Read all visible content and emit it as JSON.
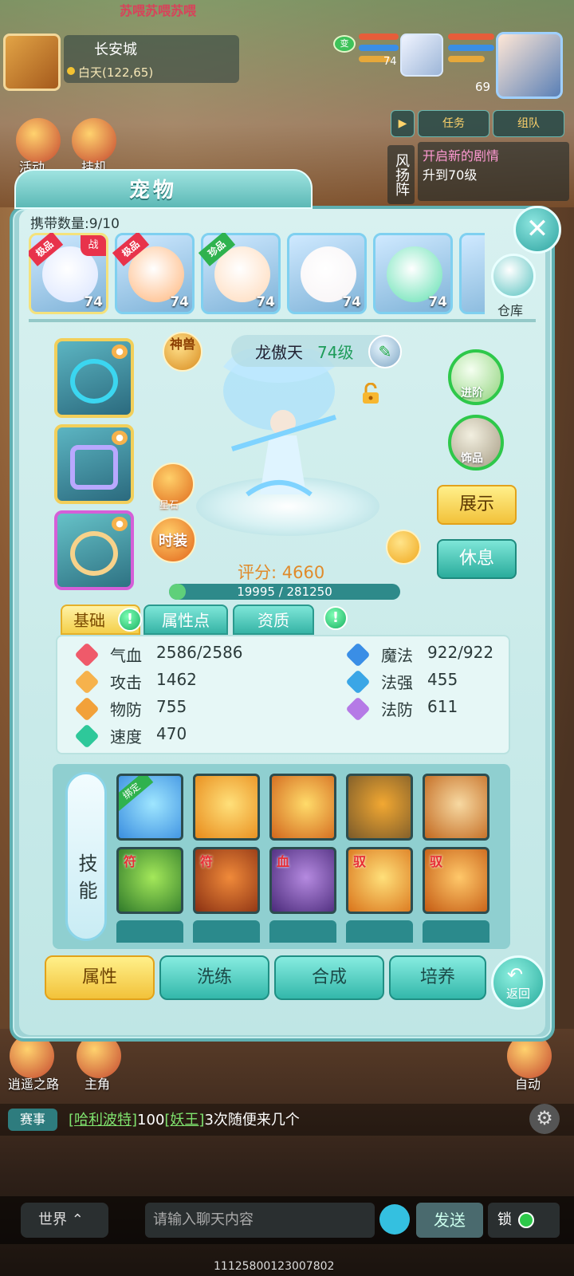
{
  "hud": {
    "marquee": "苏喂苏喂苏喂",
    "city_name": "长安城",
    "city_coords": "白天(122,65)",
    "team_badge": "变",
    "member_small_level": "74",
    "member_large_level": "69",
    "quest_tab": "任务",
    "team_tab": "组队",
    "formation_label": "风扬阵",
    "quest_title": "开启新的剧情",
    "quest_desc": "升到70级",
    "activity_label": "活动",
    "idle_label": "挂机",
    "xiaoyao_label": "逍遥之路",
    "hero_label": "主角",
    "auto_label": "自动"
  },
  "panel": {
    "title": "宠物",
    "carry_count": "携带数量:9/10",
    "storage_label": "仓库",
    "close_icon": "close-icon"
  },
  "pets": [
    {
      "grade": "极品",
      "level": "74",
      "tag": "战",
      "ribbon_color": "#e8334b",
      "face": "#d9e4ff"
    },
    {
      "grade": "极品",
      "level": "74",
      "tag": "",
      "ribbon_color": "#e8334b",
      "face": "#ffb57a"
    },
    {
      "grade": "珍品",
      "level": "74",
      "tag": "",
      "ribbon_color": "#2fb24e",
      "face": "#ffd9b8"
    },
    {
      "grade": "",
      "level": "74",
      "tag": "",
      "ribbon_color": "",
      "face": "#f7f3f5"
    },
    {
      "grade": "",
      "level": "74",
      "tag": "",
      "ribbon_color": "",
      "face": "#5fe0b0"
    }
  ],
  "pet_detail": {
    "divine_badge": "神兽",
    "name": "龙傲天",
    "level": "74级",
    "star_stone_label": "星石",
    "fashion_label": "时装",
    "advance_label": "进阶",
    "ornament_label": "饰品",
    "show_label": "展示",
    "rest_label": "休息",
    "score_text": "评分: 4660",
    "exp_text": "19995 / 281250",
    "exp_fraction": 0.071
  },
  "tabs": [
    {
      "label": "基础",
      "active": true
    },
    {
      "label": "属性点",
      "active": false
    },
    {
      "label": "资质",
      "active": false
    }
  ],
  "stats": {
    "hp_label": "气血",
    "hp_value": "2586/2586",
    "mp_label": "魔法",
    "mp_value": "922/922",
    "atk_label": "攻击",
    "atk_value": "1462",
    "mag_label": "法强",
    "mag_value": "455",
    "def_label": "物防",
    "def_value": "755",
    "mdef_label": "法防",
    "mdef_value": "611",
    "spd_label": "速度",
    "spd_value": "470"
  },
  "skills": {
    "label": "技能",
    "row1": [
      {
        "tag": "",
        "bound": "绑定",
        "colors": [
          "#3a8ee0",
          "#9fe6ff"
        ]
      },
      {
        "tag": "",
        "bound": "",
        "colors": [
          "#e88a1a",
          "#ffe07a"
        ]
      },
      {
        "tag": "",
        "bound": "",
        "colors": [
          "#d2661c",
          "#ffdb6a"
        ]
      },
      {
        "tag": "",
        "bound": "",
        "colors": [
          "#7a5a2a",
          "#f2a832"
        ]
      },
      {
        "tag": "",
        "bound": "",
        "colors": [
          "#c2681e",
          "#f7d9a2"
        ]
      }
    ],
    "row2": [
      {
        "tag": "符",
        "bound": "",
        "colors": [
          "#2f7a2a",
          "#a4e85a"
        ]
      },
      {
        "tag": "符",
        "bound": "",
        "colors": [
          "#8a3012",
          "#f08a3a"
        ]
      },
      {
        "tag": "血",
        "bound": "",
        "colors": [
          "#4a2a7a",
          "#b58ae0"
        ]
      },
      {
        "tag": "驭",
        "bound": "",
        "colors": [
          "#d9731a",
          "#ffe07a"
        ]
      },
      {
        "tag": "驭",
        "bound": "",
        "colors": [
          "#c45a12",
          "#ffc86a"
        ]
      }
    ]
  },
  "bottom_tabs": [
    {
      "label": "属性",
      "active": true
    },
    {
      "label": "洗练",
      "active": false
    },
    {
      "label": "合成",
      "active": false
    },
    {
      "label": "培养",
      "active": false
    }
  ],
  "back_label": "返回",
  "chat": {
    "race_tag": "赛事",
    "player": "[哈利波特]",
    "mid": "100",
    "boss": "[妖王]",
    "tail": "3次随便来几个",
    "channel": "世界",
    "placeholder": "请输入聊天内容",
    "send_label": "发送",
    "lock_label": "锁",
    "counter": "11125800123007802"
  }
}
